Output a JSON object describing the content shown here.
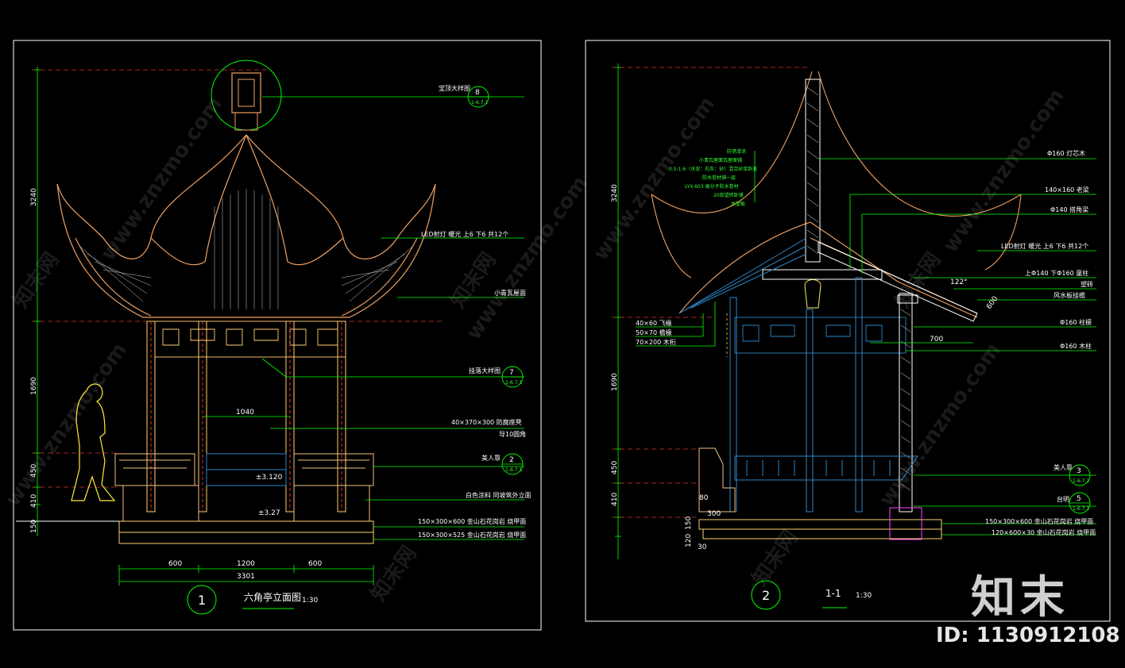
{
  "left_sheet": {
    "callouts": {
      "top_detail": "宝顶大样图",
      "led": "LED射灯 暖光 上6 下6 共12个",
      "roof": "小青瓦屋面",
      "eave_detail": "挂落大样图",
      "bench_board": "40×370×300 防腐座凳",
      "bench_board2": "导10圆角",
      "seat": "美人靠",
      "paint": "白色涂料 同坡筑外立面",
      "step1": "150×300×600 金山石花岗岩 烧甲面",
      "step2": "150×300×525 金山石花岗岩 烧甲面"
    },
    "tags": {
      "t8_num": "8",
      "t8_sub": "1-6.7.1",
      "t7_num": "7",
      "t7_sub": "1-6.7.1",
      "t2_num": "2",
      "t2_sub": "1-6.7.1"
    },
    "dims": {
      "v1": "3240",
      "v2": "1690",
      "v3": "450",
      "v4": "410",
      "v5": "150",
      "span_inner": "1040",
      "h1": "600",
      "h2": "1200",
      "h3": "600",
      "total": "3301",
      "lvl1": "±3.120",
      "lvl2": "±3.27"
    },
    "title": {
      "number": "1",
      "name": "六角亭立面图",
      "scale": "1:30"
    }
  },
  "right_sheet": {
    "callouts": {
      "mast": "Φ160 灯芯木",
      "beam": "140×160 老梁",
      "rafter": "Φ140 搭角梁",
      "led": "LED射灯 暖光 上6 下6 共12个",
      "bracket": "上Φ140 下Φ160 童柱",
      "fascia": "望砖",
      "fascia2": "风水板挂檐",
      "col1": "Φ160 柱檩",
      "col2": "Φ160 木柱",
      "seat": "美人靠",
      "base": "台明",
      "step1": "150×300×600 金山石花岗岩 烧甲面",
      "step2": "120×600×30 金山石花岗岩 烧甲面"
    },
    "left_callouts": {
      "a": "40×60 飞椽",
      "b": "50×70 檐椽",
      "c": "70×200 木桁"
    },
    "roof_notes": [
      "防锈漆涂",
      "小青瓦屋面瓦屋面铺",
      "0.5:1:6（水泥：石灰：砂）混合砂浆卧底",
      "防水卷材铺一层",
      "LYX-603 高分子防水卷材",
      "20厚望砖卧铺",
      "木望板"
    ],
    "tags": {
      "t3_num": "3",
      "t3_sub": "1-6.7.1",
      "t5_num": "5",
      "t5_sub": "1-6.7.1"
    },
    "dims": {
      "v1": "3240",
      "v2": "1690",
      "v3": "450",
      "v4": "410",
      "v5": "150",
      "v6": "120",
      "v7": "30",
      "d80": "80",
      "d300": "300",
      "angle": "122°",
      "slope": "600",
      "eave": "700"
    },
    "title": {
      "number": "2",
      "name": "1-1",
      "scale": "1:30"
    }
  },
  "watermarks": [
    "www.znzmo.com",
    "知末网"
  ],
  "brand": {
    "logo": "知末",
    "id": "ID: 1130912108"
  },
  "colors": {
    "background": "#000000",
    "frame": "#ffffff",
    "leader": "#00ff00",
    "roof": "#f0a060",
    "structure": "#ffd070",
    "timber": "#e05050",
    "railing": "#2b86c8",
    "detail": "#ffee66"
  }
}
